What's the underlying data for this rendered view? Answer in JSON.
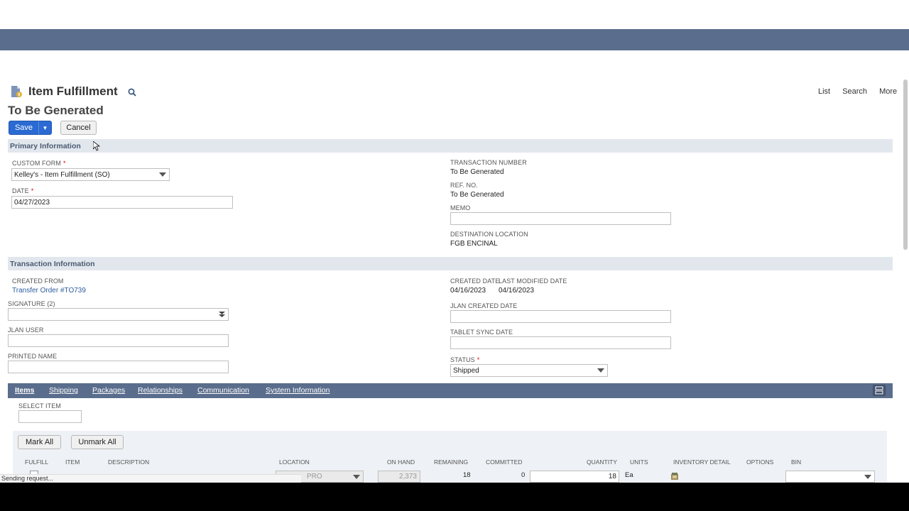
{
  "header": {
    "title": "Item Fulfillment",
    "subtitle": "To Be Generated",
    "links": {
      "list": "List",
      "search": "Search",
      "more": "More"
    }
  },
  "toolbar": {
    "save": "Save",
    "save_menu": "▼",
    "cancel": "Cancel"
  },
  "primary": {
    "section": "Primary Information",
    "custom_form_label": "CUSTOM FORM",
    "custom_form_value": "Kelley's - Item Fulfillment (SO)",
    "date_label": "DATE",
    "date_value": "04/27/2023",
    "transaction_number_label": "TRANSACTION NUMBER",
    "transaction_number_value": "To Be Generated",
    "ref_no_label": "REF. NO.",
    "ref_no_value": "To Be Generated",
    "memo_label": "MEMO",
    "destination_location_label": "DESTINATION LOCATION",
    "destination_location_value": "FGB ENCINAL",
    "required_mark": "*"
  },
  "transaction": {
    "section": "Transaction Information",
    "created_from_label": "CREATED FROM",
    "created_from_value": "Transfer Order #TO739",
    "signature_label": "SIGNATURE (2)",
    "jlan_user_label": "JLAN USER",
    "printed_name_label": "PRINTED NAME",
    "created_date_label": "CREATED DATE",
    "created_date_value": "04/16/2023",
    "last_modified_label": "LAST MODIFIED DATE",
    "last_modified_value": "04/16/2023",
    "jlan_created_label": "JLAN CREATED DATE",
    "tablet_sync_label": "TABLET SYNC DATE",
    "status_label": "STATUS",
    "status_value": "Shipped"
  },
  "tabs": [
    "Items",
    "Shipping",
    "Packages",
    "Relationships",
    "Communication",
    "System Information"
  ],
  "items": {
    "select_item_label": "SELECT ITEM",
    "mark_all": "Mark All",
    "unmark_all": "Unmark All",
    "columns": [
      "FULFILL",
      "ITEM",
      "DESCRIPTION",
      "LOCATION",
      "ON HAND",
      "REMAINING",
      "COMMITTED",
      "QUANTITY",
      "UNITS",
      "INVENTORY DETAIL",
      "OPTIONS",
      "BIN"
    ],
    "row": {
      "location": "PRO",
      "on_hand": "2,373",
      "remaining": "18",
      "committed": "0",
      "quantity": "18",
      "units": "Ea"
    }
  },
  "status_bar": "Sending request...",
  "colors": {
    "nav": "#5a6d8c",
    "primary_button": "#2b6ad2",
    "section_bar": "#e2e7ee",
    "link": "#2d5d9f"
  }
}
